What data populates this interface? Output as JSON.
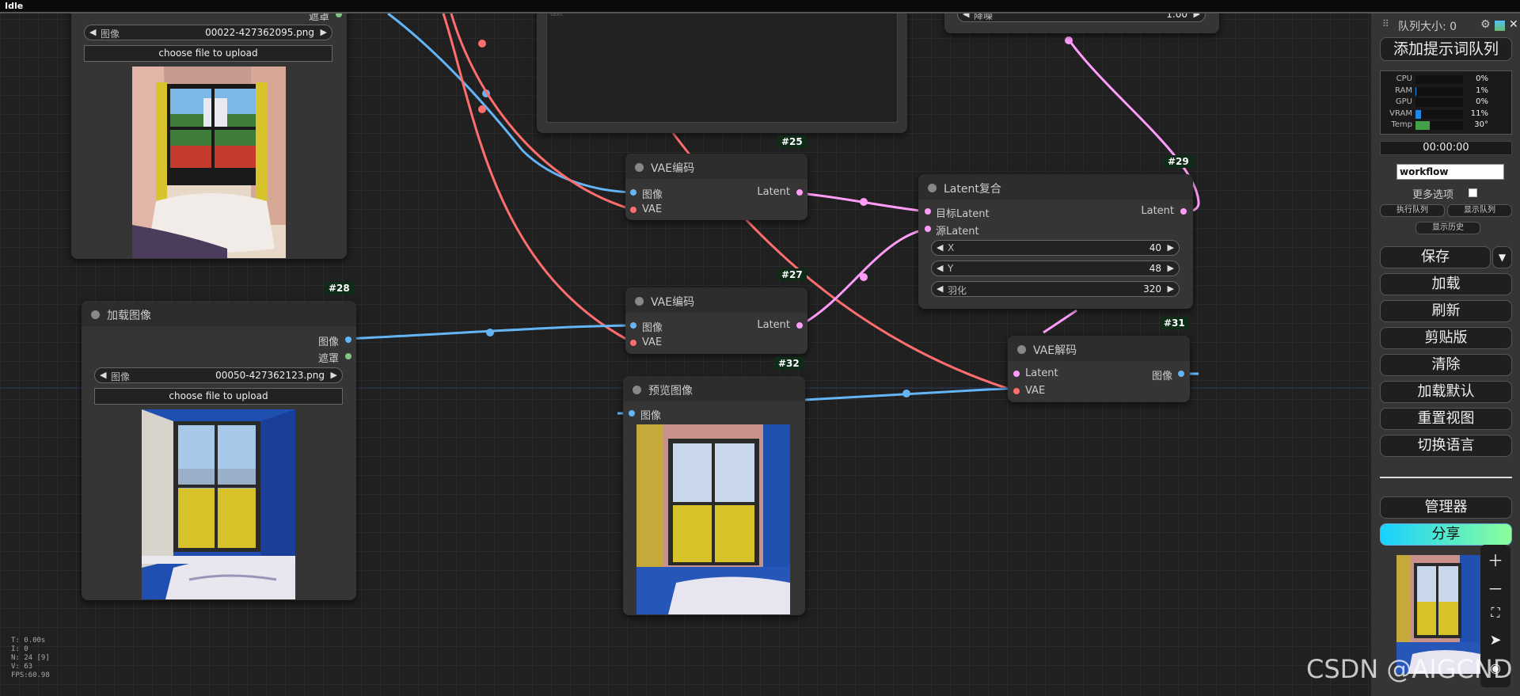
{
  "app": {
    "status": "Idle"
  },
  "colors": {
    "image_wire": "#64b5f6",
    "vae_wire": "#ff6e6e",
    "latent_wire": "#ff9cf9",
    "mask_pin": "#81c784",
    "node_id_bg": "#0d2b17",
    "share_gradient_start": "#17d1ff",
    "share_gradient_end": "#8bff9b"
  },
  "nodes": {
    "load_image_top": {
      "mask_label": "遮罩",
      "image_widget": {
        "label": "图像",
        "value": "00022-427362095.png"
      },
      "upload_label": "choose file to upload"
    },
    "load_image_28": {
      "id": "#28",
      "title": "加载图像",
      "outputs": [
        "图像",
        "遮罩"
      ],
      "image_widget": {
        "label": "图像",
        "value": "00050-427362123.png"
      },
      "upload_label": "choose file to upload"
    },
    "vae_encode_25": {
      "id": "#25",
      "title": "VAE编码",
      "inputs": [
        "图像",
        "VAE"
      ],
      "output": "Latent"
    },
    "vae_encode_27": {
      "id": "#27",
      "title": "VAE编码",
      "inputs": [
        "图像",
        "VAE"
      ],
      "output": "Latent"
    },
    "latent_composite_29": {
      "id": "#29",
      "title": "Latent复合",
      "inputs": [
        "目标Latent",
        "源Latent"
      ],
      "output": "Latent",
      "widgets": [
        {
          "label": "X",
          "value": "40"
        },
        {
          "label": "Y",
          "value": "48"
        },
        {
          "label": "羽化",
          "value": "320"
        }
      ]
    },
    "vae_decode_31": {
      "id": "#31",
      "title": "VAE解码",
      "inputs": [
        "Latent",
        "VAE"
      ],
      "output": "图像"
    },
    "preview_32": {
      "id": "#32",
      "title": "预览图像",
      "input": "图像"
    },
    "top_right_partial": {
      "widget_label": "降噪",
      "widget_value": "1.00"
    },
    "text_box": {
      "placeholder": "text"
    }
  },
  "panel": {
    "queue_size": "队列大小: 0",
    "queue_prompt": "添加提示词队列",
    "monitor": [
      {
        "label": "CPU",
        "value": "0%",
        "fill": 0,
        "color": "#1e88e5"
      },
      {
        "label": "RAM",
        "value": "1%",
        "fill": 0.01,
        "color": "#1e88e5"
      },
      {
        "label": "GPU",
        "value": "0%",
        "fill": 0,
        "color": "#1e88e5"
      },
      {
        "label": "VRAM",
        "value": "11%",
        "fill": 0.11,
        "color": "#1e88e5"
      },
      {
        "label": "Temp",
        "value": "30°",
        "fill": 0.3,
        "color": "#43a047"
      }
    ],
    "timer": "00:00:00",
    "workflow_value": "workflow",
    "more_options": "更多选项",
    "view_queue": "执行队列",
    "show_queue": "显示队列",
    "show_history": "显示历史",
    "save": "保存",
    "save_arrow": "▼",
    "load": "加载",
    "refresh": "刷新",
    "clipspace": "剪贴版",
    "clear": "清除",
    "load_default": "加载默认",
    "reset_view": "重置视图",
    "switch_locale": "切换语言",
    "manager": "管理器",
    "share": "分享"
  },
  "stats": [
    "T: 0.00s",
    "I: 0",
    "N: 24 [9]",
    "V: 63",
    "FPS:60.98"
  ],
  "watermark": "CSDN @AIGCND"
}
